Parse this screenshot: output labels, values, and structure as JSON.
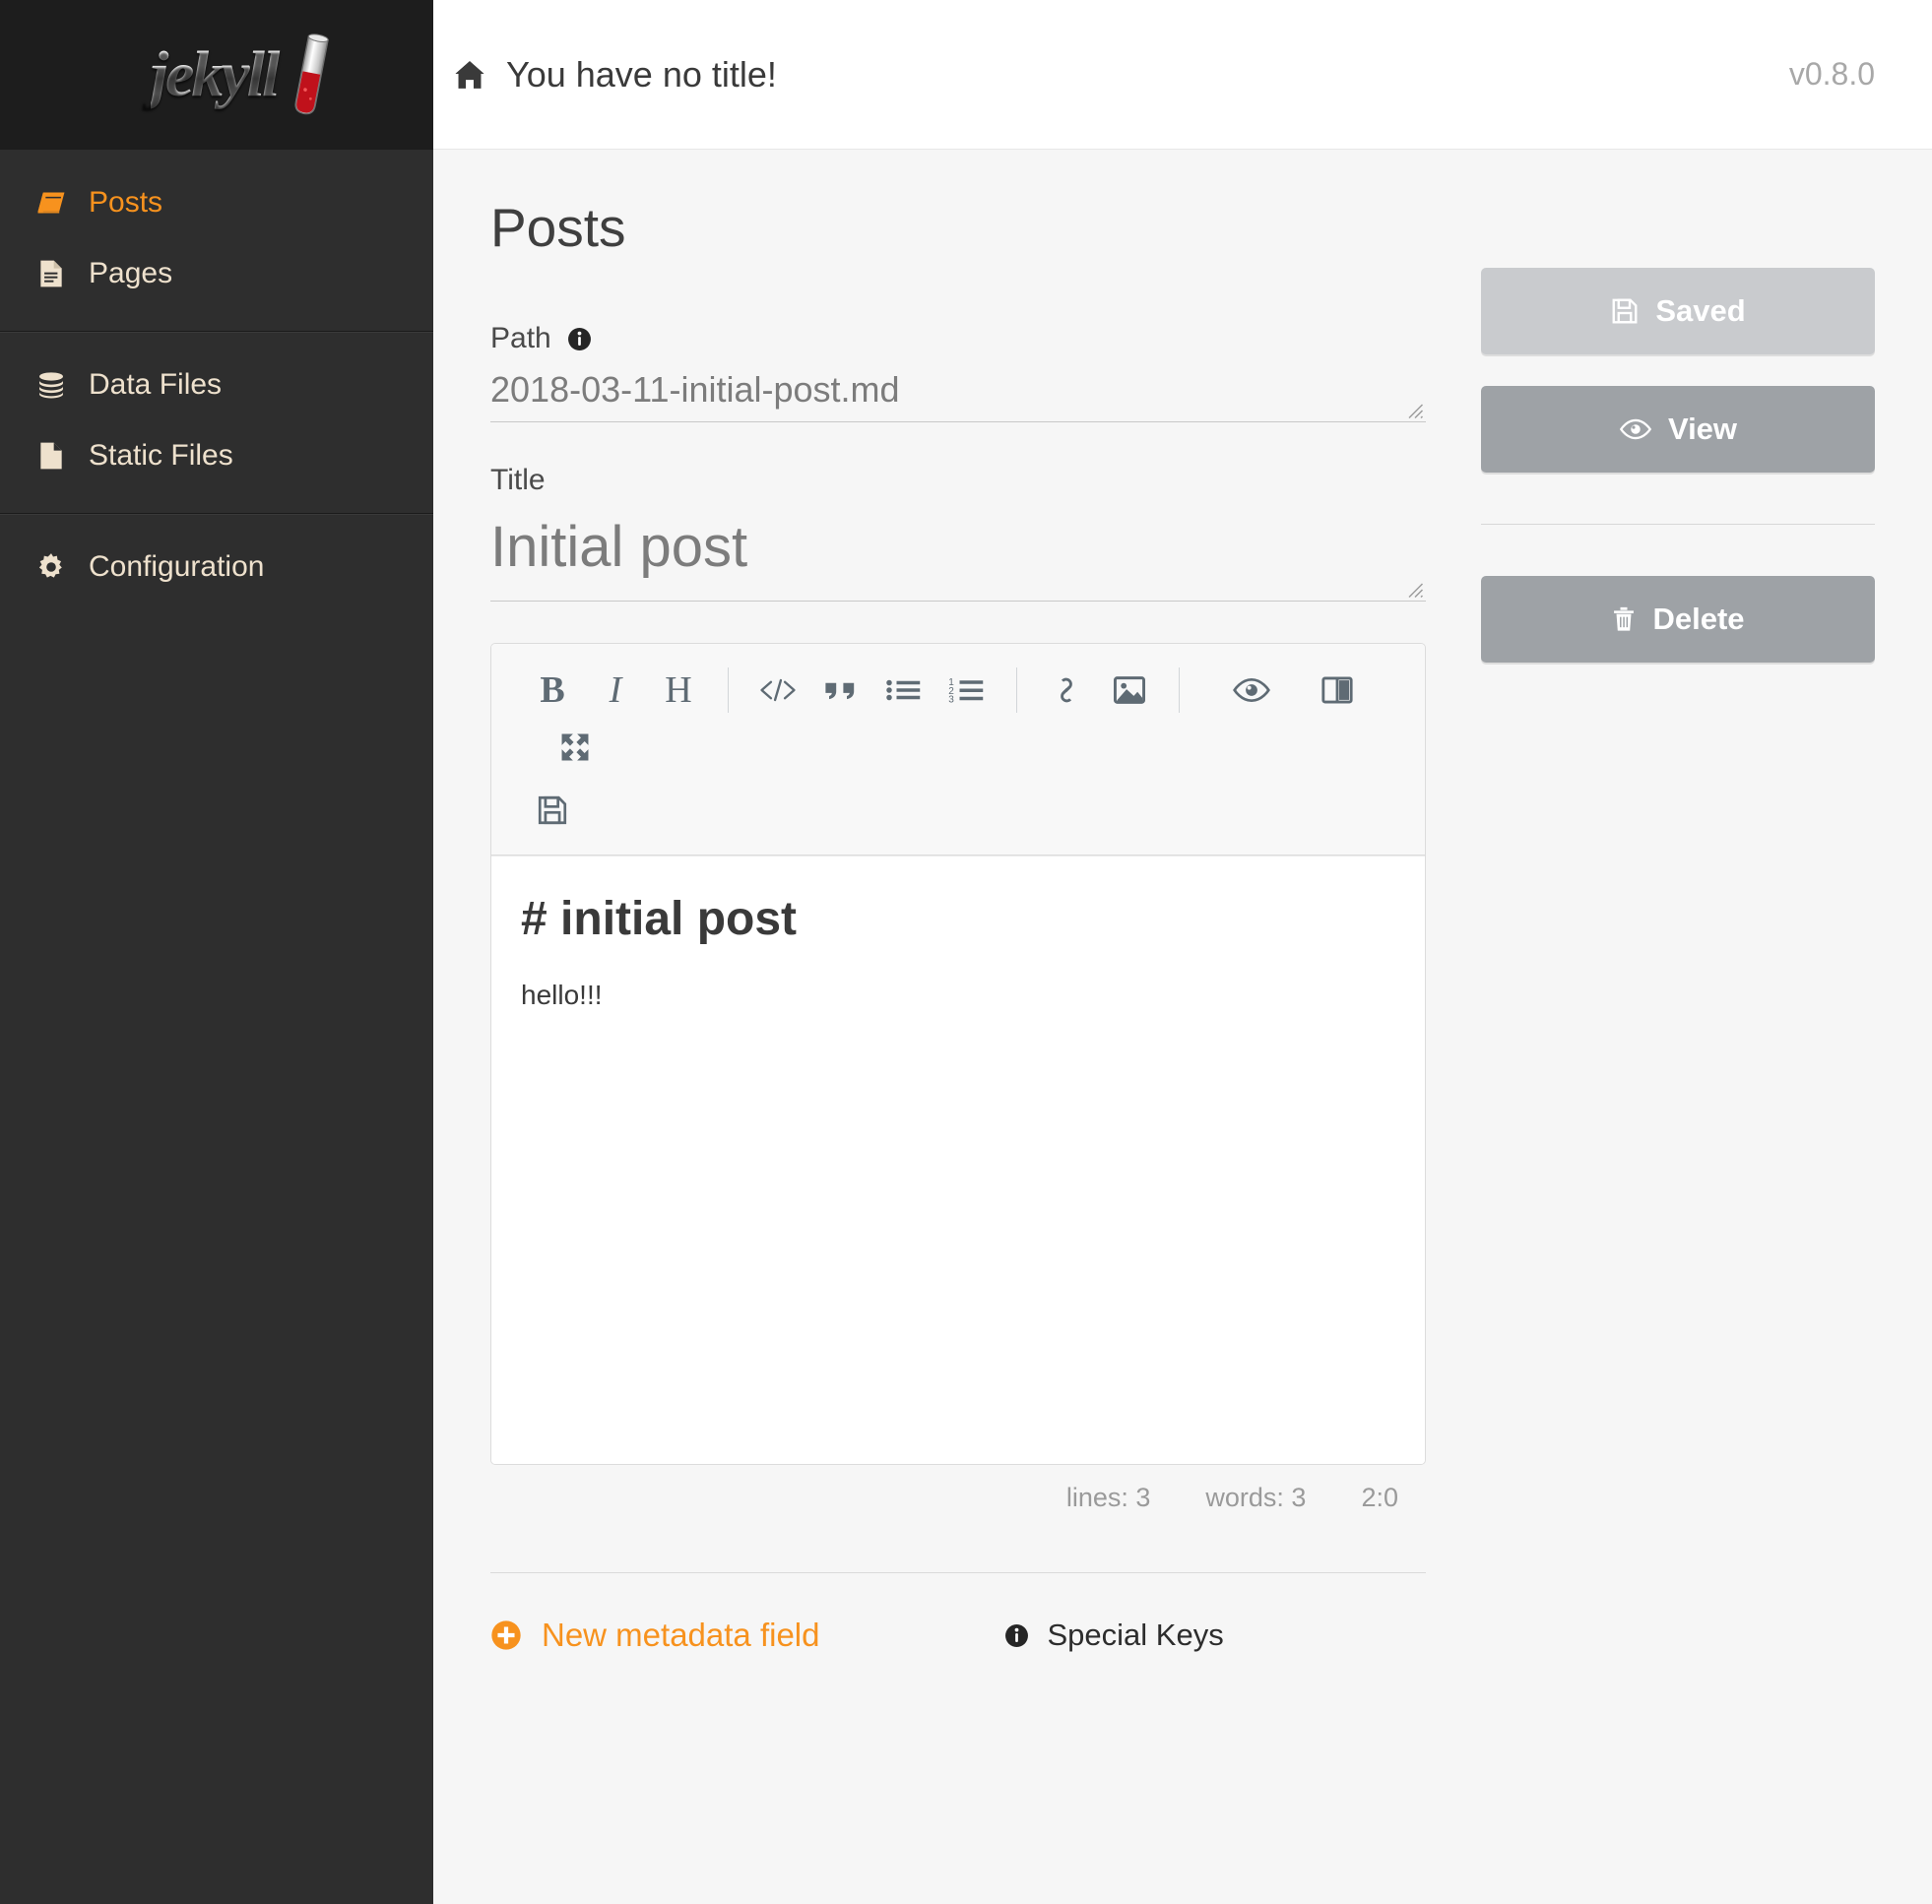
{
  "brand": {
    "logo_text": "jekyll",
    "accent": "#f7921e"
  },
  "topbar": {
    "home_icon": "home-icon",
    "title": "You have no title!",
    "version": "v0.8.0"
  },
  "sidebar": {
    "groups": [
      {
        "items": [
          {
            "label": "Posts",
            "icon": "book-icon",
            "active": true
          },
          {
            "label": "Pages",
            "icon": "file-text-icon",
            "active": false
          }
        ]
      },
      {
        "items": [
          {
            "label": "Data Files",
            "icon": "database-icon",
            "active": false
          },
          {
            "label": "Static Files",
            "icon": "file-icon",
            "active": false
          }
        ]
      },
      {
        "items": [
          {
            "label": "Configuration",
            "icon": "gear-icon",
            "active": false
          }
        ]
      }
    ]
  },
  "page": {
    "heading": "Posts",
    "path_field": {
      "label": "Path",
      "info_icon": "info-circle-icon",
      "value": "2018-03-11-initial-post.md",
      "placeholder": "Path"
    },
    "title_field": {
      "label": "Title",
      "value": "Initial post",
      "placeholder": "Title"
    }
  },
  "editor": {
    "toolbar": [
      {
        "name": "bold-icon",
        "label": "B"
      },
      {
        "name": "italic-icon",
        "label": "I"
      },
      {
        "name": "heading-icon",
        "label": "H"
      },
      {
        "name": "separator",
        "label": ""
      },
      {
        "name": "code-icon",
        "label": ""
      },
      {
        "name": "quote-icon",
        "label": ""
      },
      {
        "name": "unordered-list-icon",
        "label": ""
      },
      {
        "name": "ordered-list-icon",
        "label": ""
      },
      {
        "name": "separator",
        "label": ""
      },
      {
        "name": "link-icon",
        "label": ""
      },
      {
        "name": "image-icon",
        "label": ""
      },
      {
        "name": "separator",
        "label": ""
      },
      {
        "name": "preview-eye-icon",
        "label": ""
      },
      {
        "name": "side-by-side-icon",
        "label": ""
      },
      {
        "name": "fullscreen-icon",
        "label": ""
      },
      {
        "name": "save-floppy-icon",
        "label": ""
      }
    ],
    "content_heading": "# initial post",
    "content_body": "hello!!!",
    "status": {
      "lines": "lines: 3",
      "words": "words: 3",
      "cursor": "2:0"
    }
  },
  "footer": {
    "new_metadata_label": "New metadata field",
    "new_metadata_icon": "plus-circle-icon",
    "special_keys_label": "Special Keys",
    "special_keys_icon": "info-circle-icon"
  },
  "actions": {
    "saved": {
      "label": "Saved",
      "icon": "floppy-icon",
      "color": "#c9cbce"
    },
    "view": {
      "label": "View",
      "icon": "eye-icon",
      "color": "#9ea2a6"
    },
    "delete": {
      "label": "Delete",
      "icon": "trash-icon",
      "color": "#9ea2a6"
    }
  }
}
